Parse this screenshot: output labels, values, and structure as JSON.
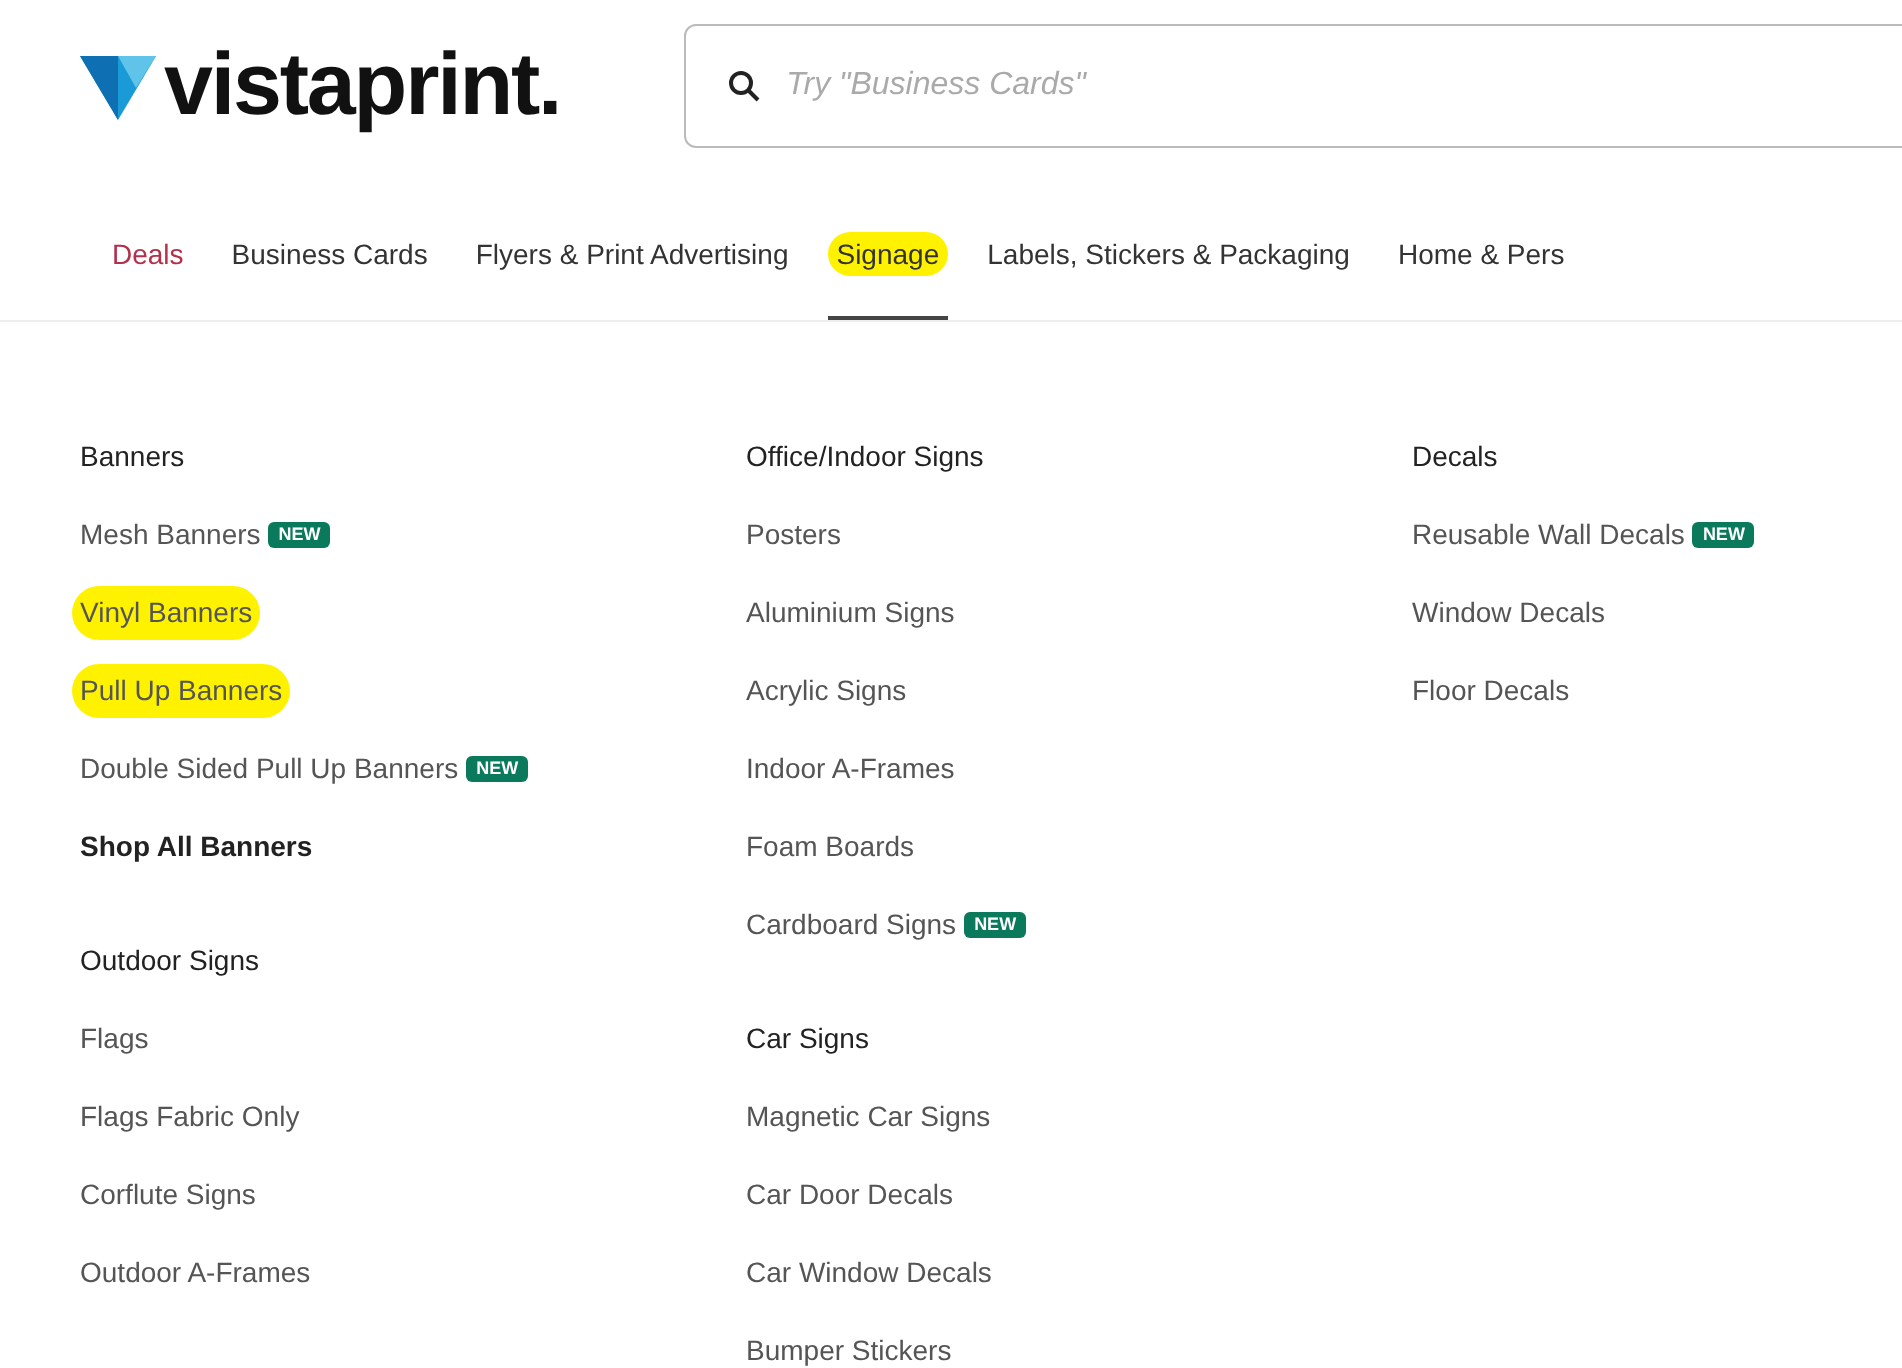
{
  "logo": {
    "text": "vistaprint."
  },
  "search": {
    "placeholder": "Try \"Business Cards\""
  },
  "nav": [
    {
      "label": "Deals",
      "kind": "deal",
      "selected": false,
      "highlighted": false
    },
    {
      "label": "Business Cards",
      "kind": "link",
      "selected": false,
      "highlighted": false
    },
    {
      "label": "Flyers & Print Advertising",
      "kind": "link",
      "selected": false,
      "highlighted": false
    },
    {
      "label": "Signage",
      "kind": "link",
      "selected": true,
      "highlighted": true
    },
    {
      "label": "Labels, Stickers & Packaging",
      "kind": "link",
      "selected": false,
      "highlighted": false
    },
    {
      "label": "Home & Pers",
      "kind": "link",
      "selected": false,
      "highlighted": false
    }
  ],
  "columns": [
    [
      {
        "heading": "Banners",
        "items": [
          {
            "label": "Mesh Banners",
            "kind": "link",
            "badge": "NEW",
            "highlighted": false
          },
          {
            "label": "Vinyl Banners",
            "kind": "link",
            "highlighted": true
          },
          {
            "label": "Pull Up Banners",
            "kind": "link",
            "highlighted": true
          },
          {
            "label": "Double Sided Pull Up Banners",
            "kind": "link",
            "badge": "NEW",
            "highlighted": false
          },
          {
            "label": "Shop All Banners",
            "kind": "shop-all",
            "highlighted": false
          }
        ]
      },
      {
        "heading": "Outdoor Signs",
        "items": [
          {
            "label": "Flags",
            "kind": "link",
            "highlighted": false
          },
          {
            "label": "Flags Fabric Only",
            "kind": "link",
            "highlighted": false
          },
          {
            "label": "Corflute Signs",
            "kind": "link",
            "highlighted": false
          },
          {
            "label": "Outdoor A-Frames",
            "kind": "link",
            "highlighted": false
          }
        ]
      }
    ],
    [
      {
        "heading": "Office/Indoor Signs",
        "items": [
          {
            "label": "Posters",
            "kind": "link",
            "highlighted": false
          },
          {
            "label": "Aluminium Signs",
            "kind": "link",
            "highlighted": false
          },
          {
            "label": "Acrylic Signs",
            "kind": "link",
            "highlighted": false
          },
          {
            "label": "Indoor A-Frames",
            "kind": "link",
            "highlighted": false
          },
          {
            "label": "Foam Boards",
            "kind": "link",
            "highlighted": false
          },
          {
            "label": "Cardboard Signs",
            "kind": "link",
            "badge": "NEW",
            "highlighted": false
          }
        ]
      },
      {
        "heading": "Car Signs",
        "items": [
          {
            "label": "Magnetic Car Signs",
            "kind": "link",
            "highlighted": false
          },
          {
            "label": "Car Door Decals",
            "kind": "link",
            "highlighted": false
          },
          {
            "label": "Car Window Decals",
            "kind": "link",
            "highlighted": false
          },
          {
            "label": "Bumper Stickers",
            "kind": "link",
            "highlighted": false
          }
        ]
      }
    ],
    [
      {
        "heading": "Decals",
        "items": [
          {
            "label": "Reusable Wall Decals",
            "kind": "link",
            "badge": "NEW",
            "highlighted": false
          },
          {
            "label": "Window Decals",
            "kind": "link",
            "highlighted": false
          },
          {
            "label": "Floor Decals",
            "kind": "link",
            "highlighted": false
          }
        ]
      }
    ]
  ]
}
